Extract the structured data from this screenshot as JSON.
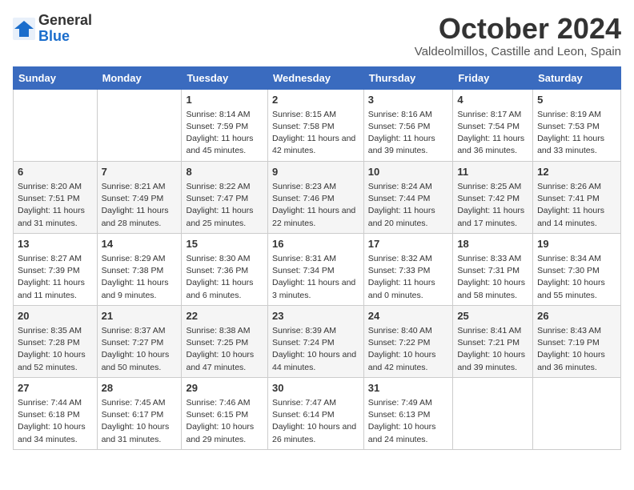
{
  "header": {
    "logo_line1": "General",
    "logo_line2": "Blue",
    "month_title": "October 2024",
    "location": "Valdeolmillos, Castille and Leon, Spain"
  },
  "days_of_week": [
    "Sunday",
    "Monday",
    "Tuesday",
    "Wednesday",
    "Thursday",
    "Friday",
    "Saturday"
  ],
  "weeks": [
    [
      {
        "day": "",
        "info": ""
      },
      {
        "day": "",
        "info": ""
      },
      {
        "day": "1",
        "info": "Sunrise: 8:14 AM\nSunset: 7:59 PM\nDaylight: 11 hours and 45 minutes."
      },
      {
        "day": "2",
        "info": "Sunrise: 8:15 AM\nSunset: 7:58 PM\nDaylight: 11 hours and 42 minutes."
      },
      {
        "day": "3",
        "info": "Sunrise: 8:16 AM\nSunset: 7:56 PM\nDaylight: 11 hours and 39 minutes."
      },
      {
        "day": "4",
        "info": "Sunrise: 8:17 AM\nSunset: 7:54 PM\nDaylight: 11 hours and 36 minutes."
      },
      {
        "day": "5",
        "info": "Sunrise: 8:19 AM\nSunset: 7:53 PM\nDaylight: 11 hours and 33 minutes."
      }
    ],
    [
      {
        "day": "6",
        "info": "Sunrise: 8:20 AM\nSunset: 7:51 PM\nDaylight: 11 hours and 31 minutes."
      },
      {
        "day": "7",
        "info": "Sunrise: 8:21 AM\nSunset: 7:49 PM\nDaylight: 11 hours and 28 minutes."
      },
      {
        "day": "8",
        "info": "Sunrise: 8:22 AM\nSunset: 7:47 PM\nDaylight: 11 hours and 25 minutes."
      },
      {
        "day": "9",
        "info": "Sunrise: 8:23 AM\nSunset: 7:46 PM\nDaylight: 11 hours and 22 minutes."
      },
      {
        "day": "10",
        "info": "Sunrise: 8:24 AM\nSunset: 7:44 PM\nDaylight: 11 hours and 20 minutes."
      },
      {
        "day": "11",
        "info": "Sunrise: 8:25 AM\nSunset: 7:42 PM\nDaylight: 11 hours and 17 minutes."
      },
      {
        "day": "12",
        "info": "Sunrise: 8:26 AM\nSunset: 7:41 PM\nDaylight: 11 hours and 14 minutes."
      }
    ],
    [
      {
        "day": "13",
        "info": "Sunrise: 8:27 AM\nSunset: 7:39 PM\nDaylight: 11 hours and 11 minutes."
      },
      {
        "day": "14",
        "info": "Sunrise: 8:29 AM\nSunset: 7:38 PM\nDaylight: 11 hours and 9 minutes."
      },
      {
        "day": "15",
        "info": "Sunrise: 8:30 AM\nSunset: 7:36 PM\nDaylight: 11 hours and 6 minutes."
      },
      {
        "day": "16",
        "info": "Sunrise: 8:31 AM\nSunset: 7:34 PM\nDaylight: 11 hours and 3 minutes."
      },
      {
        "day": "17",
        "info": "Sunrise: 8:32 AM\nSunset: 7:33 PM\nDaylight: 11 hours and 0 minutes."
      },
      {
        "day": "18",
        "info": "Sunrise: 8:33 AM\nSunset: 7:31 PM\nDaylight: 10 hours and 58 minutes."
      },
      {
        "day": "19",
        "info": "Sunrise: 8:34 AM\nSunset: 7:30 PM\nDaylight: 10 hours and 55 minutes."
      }
    ],
    [
      {
        "day": "20",
        "info": "Sunrise: 8:35 AM\nSunset: 7:28 PM\nDaylight: 10 hours and 52 minutes."
      },
      {
        "day": "21",
        "info": "Sunrise: 8:37 AM\nSunset: 7:27 PM\nDaylight: 10 hours and 50 minutes."
      },
      {
        "day": "22",
        "info": "Sunrise: 8:38 AM\nSunset: 7:25 PM\nDaylight: 10 hours and 47 minutes."
      },
      {
        "day": "23",
        "info": "Sunrise: 8:39 AM\nSunset: 7:24 PM\nDaylight: 10 hours and 44 minutes."
      },
      {
        "day": "24",
        "info": "Sunrise: 8:40 AM\nSunset: 7:22 PM\nDaylight: 10 hours and 42 minutes."
      },
      {
        "day": "25",
        "info": "Sunrise: 8:41 AM\nSunset: 7:21 PM\nDaylight: 10 hours and 39 minutes."
      },
      {
        "day": "26",
        "info": "Sunrise: 8:43 AM\nSunset: 7:19 PM\nDaylight: 10 hours and 36 minutes."
      }
    ],
    [
      {
        "day": "27",
        "info": "Sunrise: 7:44 AM\nSunset: 6:18 PM\nDaylight: 10 hours and 34 minutes."
      },
      {
        "day": "28",
        "info": "Sunrise: 7:45 AM\nSunset: 6:17 PM\nDaylight: 10 hours and 31 minutes."
      },
      {
        "day": "29",
        "info": "Sunrise: 7:46 AM\nSunset: 6:15 PM\nDaylight: 10 hours and 29 minutes."
      },
      {
        "day": "30",
        "info": "Sunrise: 7:47 AM\nSunset: 6:14 PM\nDaylight: 10 hours and 26 minutes."
      },
      {
        "day": "31",
        "info": "Sunrise: 7:49 AM\nSunset: 6:13 PM\nDaylight: 10 hours and 24 minutes."
      },
      {
        "day": "",
        "info": ""
      },
      {
        "day": "",
        "info": ""
      }
    ]
  ]
}
